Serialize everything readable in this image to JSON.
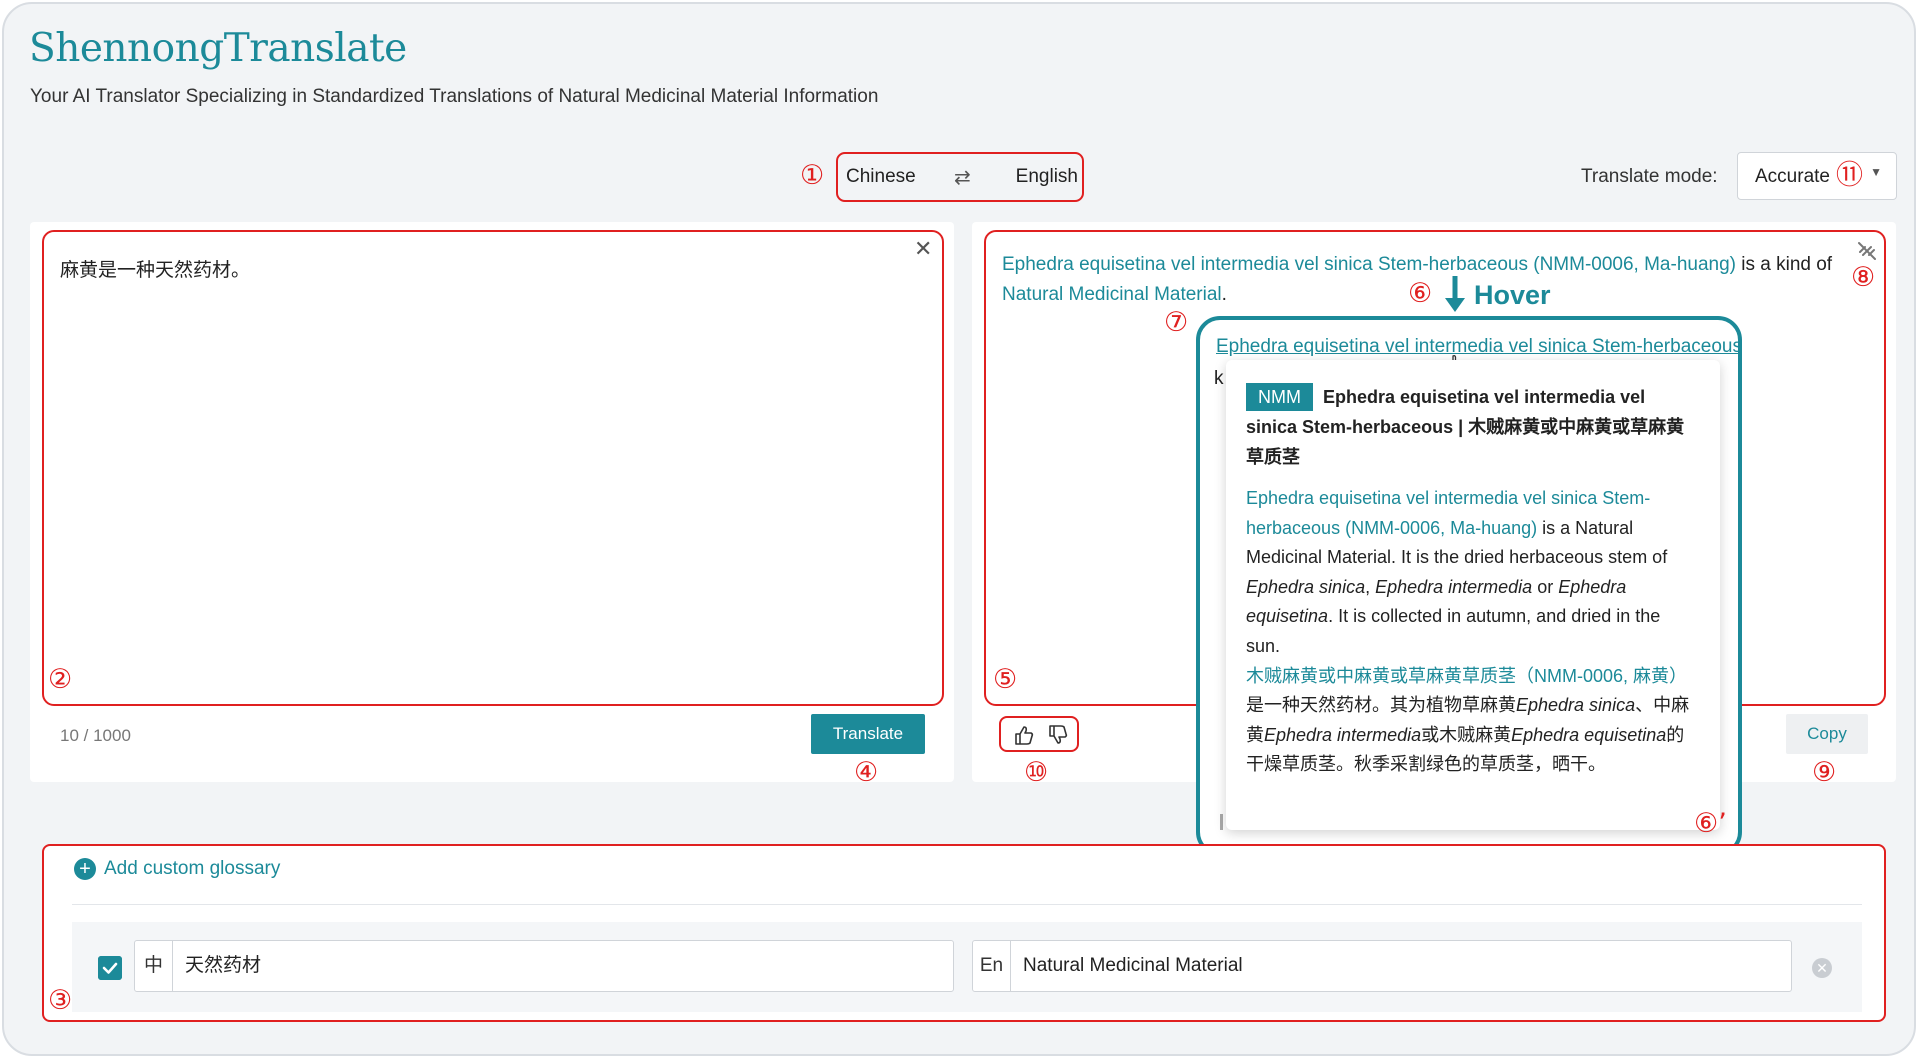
{
  "app": {
    "title": "ShennongTranslate",
    "subtitle": "Your AI Translator Specializing in Standardized Translations of Natural Medicinal Material Information"
  },
  "language": {
    "source": "Chinese",
    "target": "English",
    "swap_icon": "swap-arrows-icon"
  },
  "mode": {
    "label": "Translate mode:",
    "value": "Accurate"
  },
  "source": {
    "text": "麻黄是一种天然药材。",
    "char_count": "10 / 1000",
    "translate_label": "Translate"
  },
  "output": {
    "term1": "Ephedra equisetina vel intermedia vel sinica Stem-herbaceous (NMM-0006, Ma-huang)",
    "mid": " is a kind of ",
    "term2": "Natural Medicinal Material",
    "end": "."
  },
  "actions": {
    "copy_label": "Copy"
  },
  "hover": {
    "label": "Hover",
    "term_text": "Ephedra equisetina vel intermedia vel sinica Stem-herbaceous",
    "peek_k": "k",
    "badge": "NMM",
    "heading": "Ephedra equisetina vel intermedia vel sinica Stem-herbaceous | 木贼麻黄或中麻黄或草麻黄草质茎",
    "en_term": "Ephedra equisetina vel intermedia vel sinica Stem-herbaceous (NMM-0006, Ma-huang)",
    "en_is_a": " is a Natural Medicinal Material. It is the dried herbaceous stem of ",
    "en_sp1": "Ephedra sinica",
    "en_comma": ", ",
    "en_sp2": "Ephedra intermedia",
    "en_or": " or ",
    "en_sp3": "Ephedra equisetina",
    "en_end": ". It is collected in autumn, and dried in the sun.",
    "zh_term": "木贼麻黄或中麻黄或草麻黄草质茎（NMM-0006, 麻黄）",
    "zh_p1": "是一种天然药材。其为植物草麻黄",
    "zh_sp1": "Ephedra sinica",
    "zh_p2": "、中麻黄",
    "zh_sp2": "Ephedra intermedia",
    "zh_p3": "或木贼麻黄",
    "zh_sp3": "Ephedra equisetina",
    "zh_p4": "的干燥草质茎。秋季采割绿色的草质茎，晒干。"
  },
  "glossary": {
    "add_label": "Add custom glossary",
    "entries": [
      {
        "checked": true,
        "zh_prefix": "中",
        "zh_value": "天然药材",
        "en_prefix": "En",
        "en_value": "Natural Medicinal Material"
      }
    ]
  },
  "annotations": {
    "m1": "①",
    "m2": "②",
    "m3": "③",
    "m4": "④",
    "m5": "⑤",
    "m6": "⑥",
    "m6p": "⑥’",
    "m7": "⑦",
    "m8": "⑧",
    "m9": "⑨",
    "m10": "⑩",
    "m11": "⑪"
  },
  "colors": {
    "brand": "#1c8a99",
    "annotation": "#e02020"
  }
}
